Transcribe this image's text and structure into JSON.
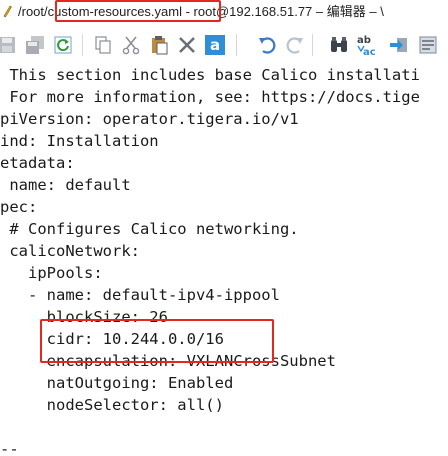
{
  "window": {
    "title_prefix": "/root/",
    "filename": "custom-resources.yaml",
    "title_suffix": " - root@192.168.51.77 – 编辑器 – \\"
  },
  "toolbar": {
    "buttons": [
      {
        "name": "save-icon"
      },
      {
        "name": "save-all-icon"
      },
      {
        "name": "reload-icon"
      },
      {
        "name": "copy-icon"
      },
      {
        "name": "cut-icon"
      },
      {
        "name": "paste-icon"
      },
      {
        "name": "delete-icon"
      },
      {
        "name": "select-all-icon"
      },
      {
        "name": "undo-icon"
      },
      {
        "name": "redo-icon"
      },
      {
        "name": "find-icon"
      },
      {
        "name": "replace-icon"
      },
      {
        "name": "goto-icon"
      },
      {
        "name": "wrap-icon"
      }
    ]
  },
  "editor": {
    "lines": [
      " This section includes base Calico installati",
      " For more information, see: https://docs.tige",
      "piVersion: operator.tigera.io/v1",
      "ind: Installation",
      "etadata:",
      " name: default",
      "pec:",
      " # Configures Calico networking.",
      " calicoNetwork:",
      "   ipPools:",
      "   - name: default-ipv4-ippool",
      "     blockSize: 26",
      "     cidr: 10.244.0.0/16",
      "     encapsulation: VXLANCrossSubnet",
      "     natOutgoing: Enabled",
      "     nodeSelector: all()",
      "",
      "--"
    ]
  },
  "colors": {
    "highlight": "#e5281f",
    "icon_blue": "#3a78c8",
    "icon_gray": "#8a8f96"
  }
}
